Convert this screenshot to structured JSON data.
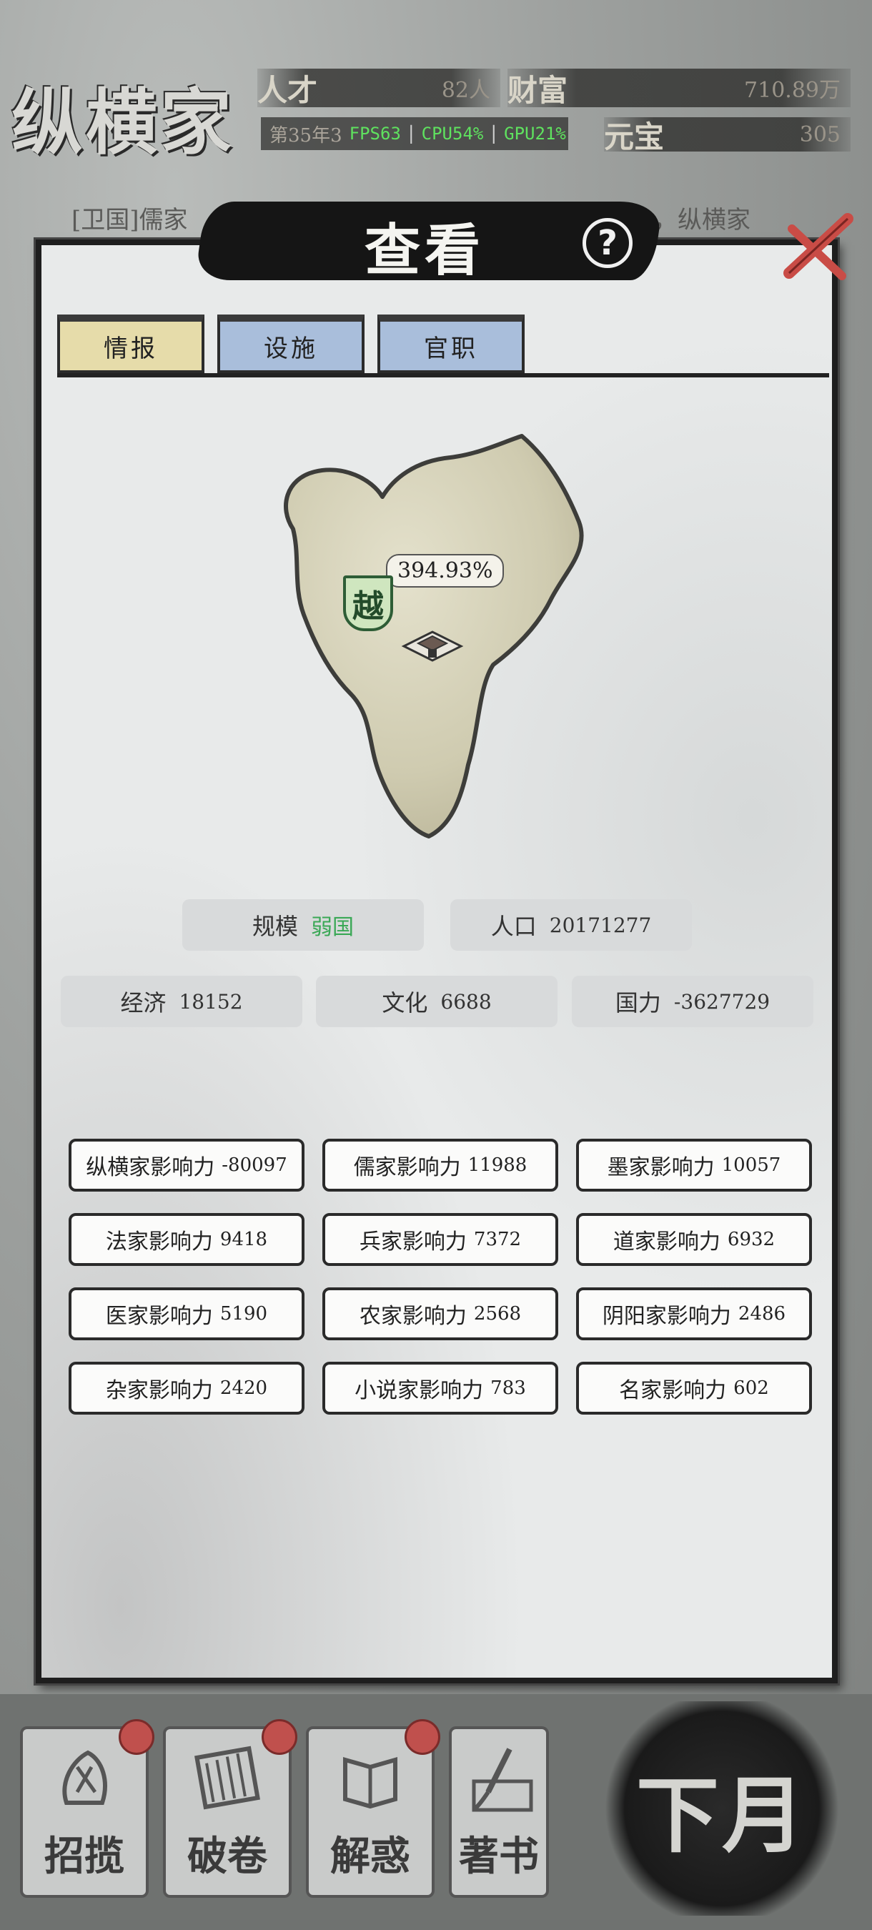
{
  "hud": {
    "title": "纵横家",
    "talent_label": "人才",
    "talent_value": "82人",
    "wealth_label": "财富",
    "wealth_value": "710.89万",
    "year": "第35年3",
    "fps": "FPS63",
    "cpu": "CPU54%",
    "gpu": "GPU21%",
    "ingot_label": "元宝",
    "ingot_value": "305"
  },
  "background": {
    "note_left": "[卫国]儒家",
    "note_right": "力，纵横家"
  },
  "dialog": {
    "title": "查看",
    "help_icon": "question-circle-icon",
    "close_icon": "close-x-icon",
    "tabs": [
      {
        "label": "情报",
        "active": true
      },
      {
        "label": "设施",
        "active": false
      },
      {
        "label": "官职",
        "active": false
      }
    ]
  },
  "map": {
    "state_flag": "越",
    "percentage": "394.93%",
    "city_icon": "city-gate-icon"
  },
  "stats": {
    "scale_label": "规模",
    "scale_value": "弱国",
    "population_label": "人口",
    "population_value": "20171277",
    "economy_label": "经济",
    "economy_value": "18152",
    "culture_label": "文化",
    "culture_value": "6688",
    "power_label": "国力",
    "power_value": "-3627729"
  },
  "influence": [
    {
      "label": "纵横家影响力",
      "value": "-80097"
    },
    {
      "label": "儒家影响力",
      "value": "11988"
    },
    {
      "label": "墨家影响力",
      "value": "10057"
    },
    {
      "label": "法家影响力",
      "value": "9418"
    },
    {
      "label": "兵家影响力",
      "value": "7372"
    },
    {
      "label": "道家影响力",
      "value": "6932"
    },
    {
      "label": "医家影响力",
      "value": "5190"
    },
    {
      "label": "农家影响力",
      "value": "2568"
    },
    {
      "label": "阴阳家影响力",
      "value": "2486"
    },
    {
      "label": "杂家影响力",
      "value": "2420"
    },
    {
      "label": "小说家影响力",
      "value": "783"
    },
    {
      "label": "名家影响力",
      "value": "602"
    }
  ],
  "bottom": {
    "buttons": [
      {
        "label": "招揽",
        "icon": "recruit-icon"
      },
      {
        "label": "破卷",
        "icon": "scroll-icon"
      },
      {
        "label": "解惑",
        "icon": "book-icon"
      },
      {
        "label": "著书",
        "icon": "brush-icon"
      }
    ],
    "next_month": "下月"
  },
  "colors": {
    "weak_state": "#3aa856",
    "tab_active": "#e6dcaa",
    "tab_inactive": "#a9bedb",
    "fps_green": "#5fe25f"
  }
}
